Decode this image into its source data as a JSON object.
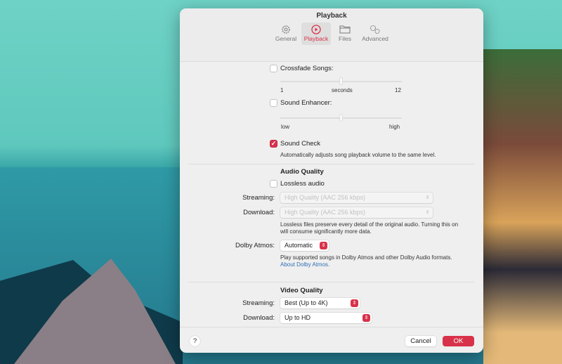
{
  "dialog": {
    "title": "Playback"
  },
  "tabs": [
    {
      "label": "General",
      "icon": "gear-icon"
    },
    {
      "label": "Playback",
      "icon": "play-circle-icon",
      "selected": true
    },
    {
      "label": "Files",
      "icon": "folder-icon"
    },
    {
      "label": "Advanced",
      "icon": "gears-icon"
    }
  ],
  "crossfade": {
    "label": "Crossfade Songs:",
    "checked": false,
    "min": "1",
    "unit": "seconds",
    "max": "12"
  },
  "enhancer": {
    "label": "Sound Enhancer:",
    "checked": false,
    "min": "low",
    "max": "high"
  },
  "soundcheck": {
    "label": "Sound Check",
    "checked": true,
    "description": "Automatically adjusts song playback volume to the same level."
  },
  "audio": {
    "heading": "Audio Quality",
    "lossless": "Lossless audio",
    "streaming_label": "Streaming:",
    "streaming_value": "High Quality (AAC 256 kbps)",
    "download_label": "Download:",
    "download_value": "High Quality (AAC 256 kbps)",
    "lossless_desc_1": "Lossless files preserve every detail of the original audio. Turning this on",
    "lossless_desc_2": "will consume significantly more data.",
    "dolby_label": "Dolby Atmos:",
    "dolby_value": "Automatic",
    "dolby_desc": "Play supported songs in Dolby Atmos and other Dolby Audio formats.",
    "dolby_link": "About Dolby Atmos."
  },
  "video": {
    "heading": "Video Quality",
    "streaming_label": "Streaming:",
    "streaming_value": "Best (Up to 4K)",
    "download_label": "Download:",
    "download_value": "Up to HD"
  },
  "footer": {
    "help": "?",
    "cancel": "Cancel",
    "ok": "OK"
  },
  "colors": {
    "accent": "#d8324a",
    "link": "#2f6fb7"
  }
}
